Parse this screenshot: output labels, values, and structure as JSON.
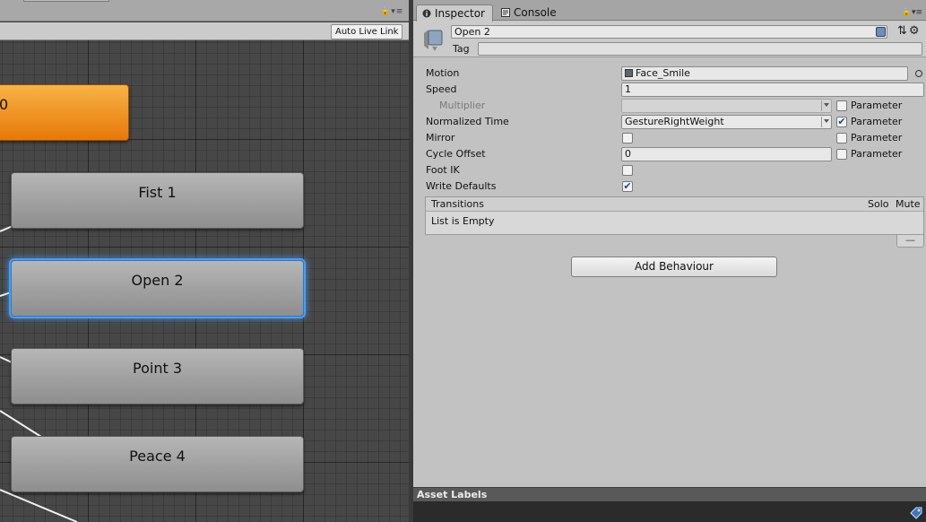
{
  "animator": {
    "auto_live_link": "Auto Live Link",
    "nodes": [
      {
        "label": "0",
        "kind": "orange"
      },
      {
        "label": "Fist 1",
        "kind": "gray"
      },
      {
        "label": "Open 2",
        "kind": "gray",
        "selected": true
      },
      {
        "label": "Point 3",
        "kind": "gray"
      },
      {
        "label": "Peace 4",
        "kind": "gray"
      }
    ]
  },
  "tabs": [
    {
      "label": "Inspector",
      "icon": "info-icon",
      "active": true
    },
    {
      "label": "Console",
      "icon": "console-icon",
      "active": false
    }
  ],
  "inspector": {
    "name": "Open 2",
    "tag_label": "Tag",
    "tag_value": "",
    "properties": {
      "motion": {
        "label": "Motion",
        "value": "Face_Smile"
      },
      "speed": {
        "label": "Speed",
        "value": "1"
      },
      "multiplier": {
        "label": "Multiplier",
        "value": "",
        "param_label": "Parameter",
        "param_checked": false
      },
      "normalized_time": {
        "label": "Normalized Time",
        "value": "GestureRightWeight",
        "param_label": "Parameter",
        "param_checked": true
      },
      "mirror": {
        "label": "Mirror",
        "checked": false,
        "param_label": "Parameter",
        "param_checked": false
      },
      "cycle_offset": {
        "label": "Cycle Offset",
        "value": "0",
        "param_label": "Parameter",
        "param_checked": false
      },
      "foot_ik": {
        "label": "Foot IK",
        "checked": false
      },
      "write_defaults": {
        "label": "Write Defaults",
        "checked": true
      }
    },
    "transitions": {
      "title": "Transitions",
      "solo": "Solo",
      "mute": "Mute",
      "empty": "List is Empty",
      "remove": "—"
    },
    "add_behaviour": "Add Behaviour",
    "asset_labels": "Asset Labels"
  },
  "colors": {
    "accent_selection": "#4a9ef2",
    "default_state": "#f08c1e"
  }
}
